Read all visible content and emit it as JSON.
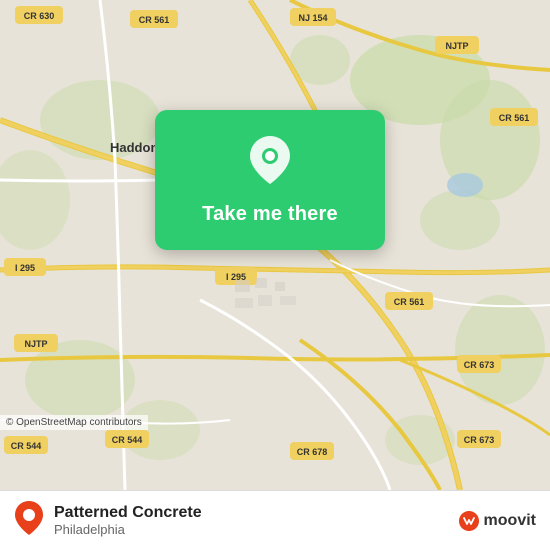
{
  "map": {
    "alt": "Map of Philadelphia area showing Haddonfield and surrounding roads"
  },
  "card": {
    "label": "Take me there",
    "icon_name": "location-pin-icon"
  },
  "bottom_bar": {
    "place_name": "Patterned Concrete",
    "place_city": "Philadelphia",
    "copyright": "© OpenStreetMap contributors",
    "moovit_text": "moovit"
  },
  "colors": {
    "card_green": "#2ecc71",
    "moovit_accent": "#e8401a"
  }
}
